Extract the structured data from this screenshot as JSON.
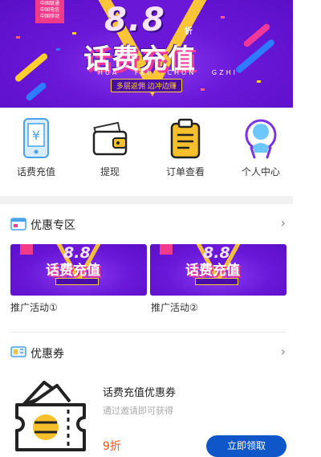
{
  "banner": {
    "carriers": [
      "中国联通",
      "中国电信",
      "中国移动"
    ],
    "headline_number": "8.8",
    "discount_unit": "折",
    "title": "话费充值",
    "pinyin": [
      "HUA",
      "FEI",
      "CHON",
      "GZHI"
    ],
    "tagline": "多层返佣  边冲边赚"
  },
  "nav": {
    "items": [
      {
        "label": "话费充值",
        "icon": "phone-recharge-icon"
      },
      {
        "label": "提现",
        "icon": "wallet-icon"
      },
      {
        "label": "订单查看",
        "icon": "clipboard-icon"
      },
      {
        "label": "个人中心",
        "icon": "user-icon"
      }
    ]
  },
  "promotions": {
    "title": "优惠专区",
    "chevron": "›",
    "items": [
      {
        "label": "推广活动①",
        "banner_title": "话费充值",
        "banner_number": "8.8"
      },
      {
        "label": "推广活动②",
        "banner_title": "话费充值",
        "banner_number": "8.8"
      }
    ]
  },
  "coupons": {
    "title": "优惠券",
    "chevron": "›",
    "item": {
      "title": "话费充值优惠券",
      "subtitle": "通过邀请即可获得",
      "discount": "9折",
      "button_label": "立即领取"
    }
  },
  "colors": {
    "banner_purple": "#6a17d8",
    "accent_yellow": "#ffcf2e",
    "accent_pink": "#f0379a",
    "button_blue": "#0f56c9",
    "discount_orange": "#f0561c"
  }
}
